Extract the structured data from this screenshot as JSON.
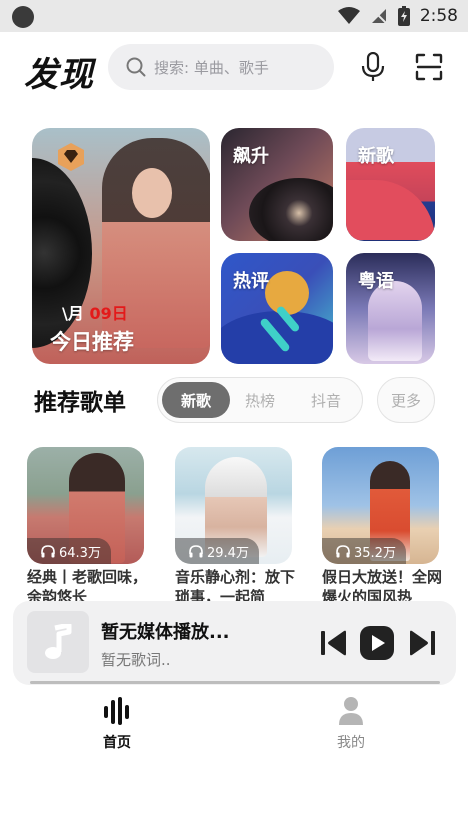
{
  "status_bar": {
    "time": "2:58"
  },
  "header": {
    "title": "发现",
    "search_placeholder": "搜索: 单曲、歌手"
  },
  "daily_card": {
    "month_suffix": "\\月",
    "day": "09日",
    "title": "今日推荐"
  },
  "mini_cards": {
    "rising": "飙升",
    "new": "新歌",
    "hot": "热评",
    "canto": "粤语"
  },
  "recommend": {
    "title": "推荐歌单",
    "tabs": [
      {
        "label": "新歌",
        "active": true
      },
      {
        "label": "热榜",
        "active": false
      },
      {
        "label": "抖音",
        "active": false
      }
    ],
    "more": "更多",
    "playlists": [
      {
        "title": "经典丨老歌回味，余韵悠长",
        "plays": "64.3万"
      },
      {
        "title": "音乐静心剂：放下琐事，一起简",
        "plays": "29.4万"
      },
      {
        "title": "假日大放送！全网爆火的国风热",
        "plays": "35.2万"
      }
    ]
  },
  "player": {
    "title": "暂无媒体播放...",
    "subtitle": "暂无歌词.."
  },
  "bottom_nav": {
    "home": "首页",
    "mine": "我的"
  },
  "colors": {
    "accent_red": "#e31a1a",
    "active_tab": "#6e6e6e",
    "inactive_text": "#b0b0b0"
  }
}
